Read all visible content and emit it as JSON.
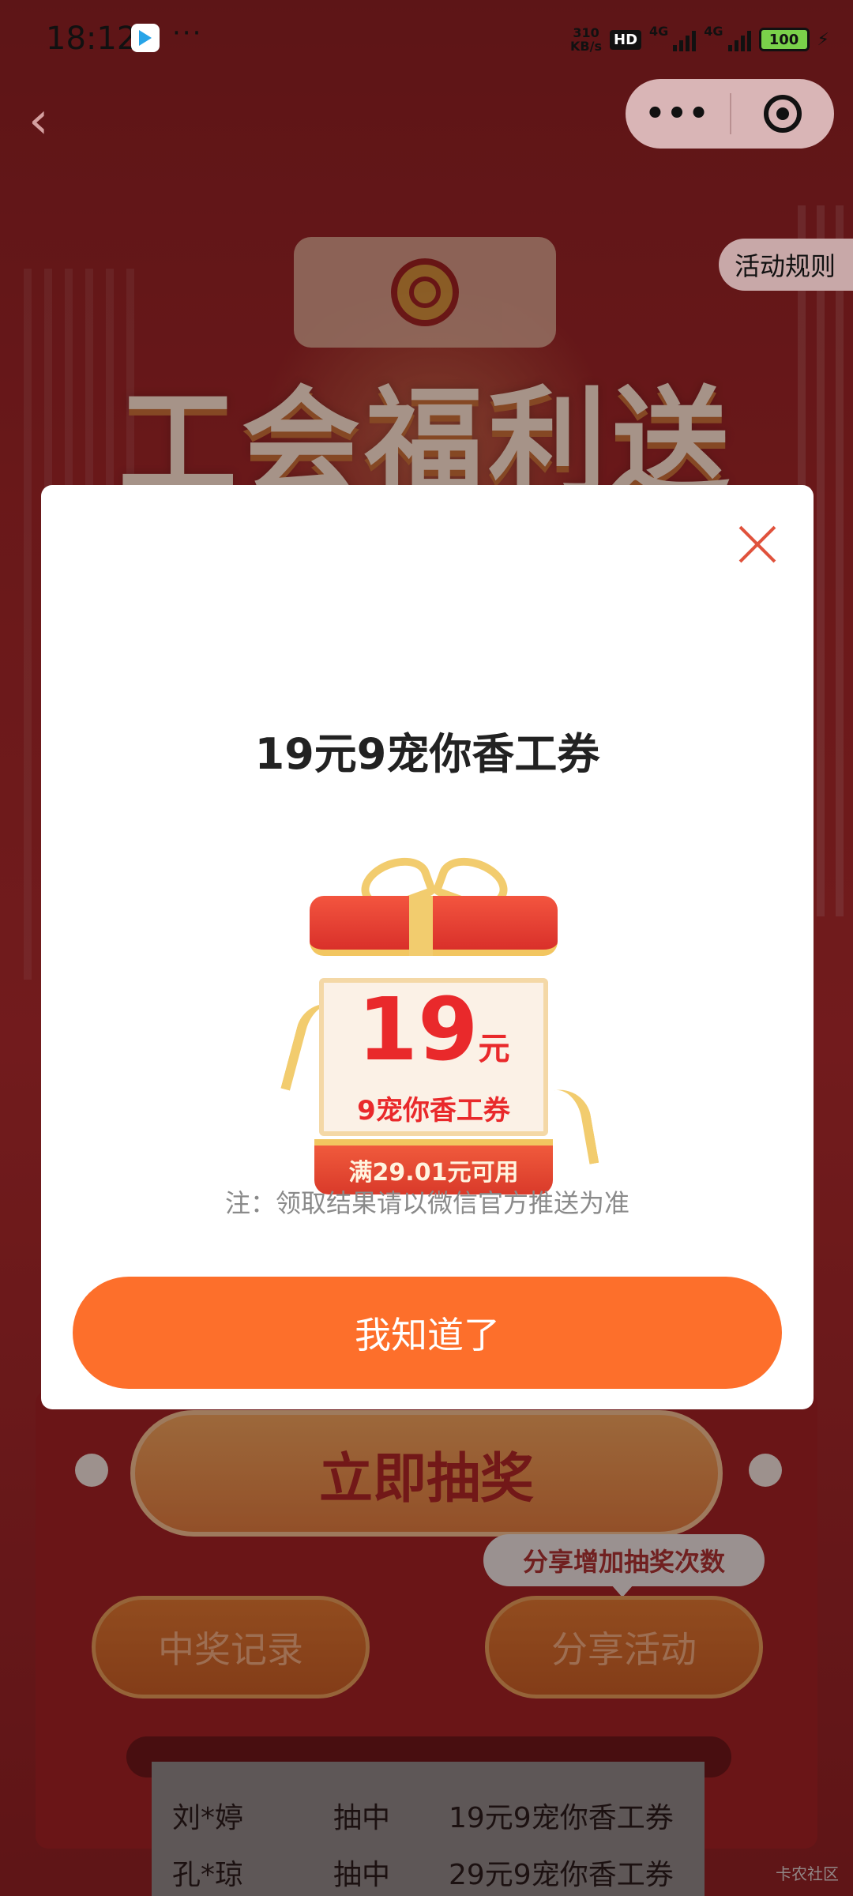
{
  "status_bar": {
    "time": "18:12",
    "more": "···",
    "net_speed_value": "310",
    "net_speed_unit": "KB/s",
    "hd": "HD",
    "sig1": "4G",
    "sig2": "4G",
    "battery": "100"
  },
  "header": {
    "back": "‹",
    "more": "•••",
    "rules_label": "活动规则"
  },
  "background": {
    "title": "工会福利送",
    "draw_button": "立即抽奖",
    "share_tip": "分享增加抽奖次数",
    "records_button": "中奖记录",
    "share_button": "分享活动",
    "winners": [
      {
        "name": "刘*婷",
        "action": "抽中",
        "prize": "19元9宠你香工券"
      },
      {
        "name": "孔*琼",
        "action": "抽中",
        "prize": "29元9宠你香工券"
      }
    ],
    "watermark": "卡农社区"
  },
  "modal": {
    "title": "19元9宠你香工券",
    "coupon": {
      "amount": "19",
      "unit": "元",
      "name": "9宠你香工券",
      "condition": "满29.01元可用"
    },
    "note": "注：领取结果请以微信官方推送为准",
    "ok_button": "我知道了"
  },
  "colors": {
    "primary_button": "#fd6f2b",
    "coupon_red": "#e9292b",
    "close_icon": "#e0523c"
  }
}
